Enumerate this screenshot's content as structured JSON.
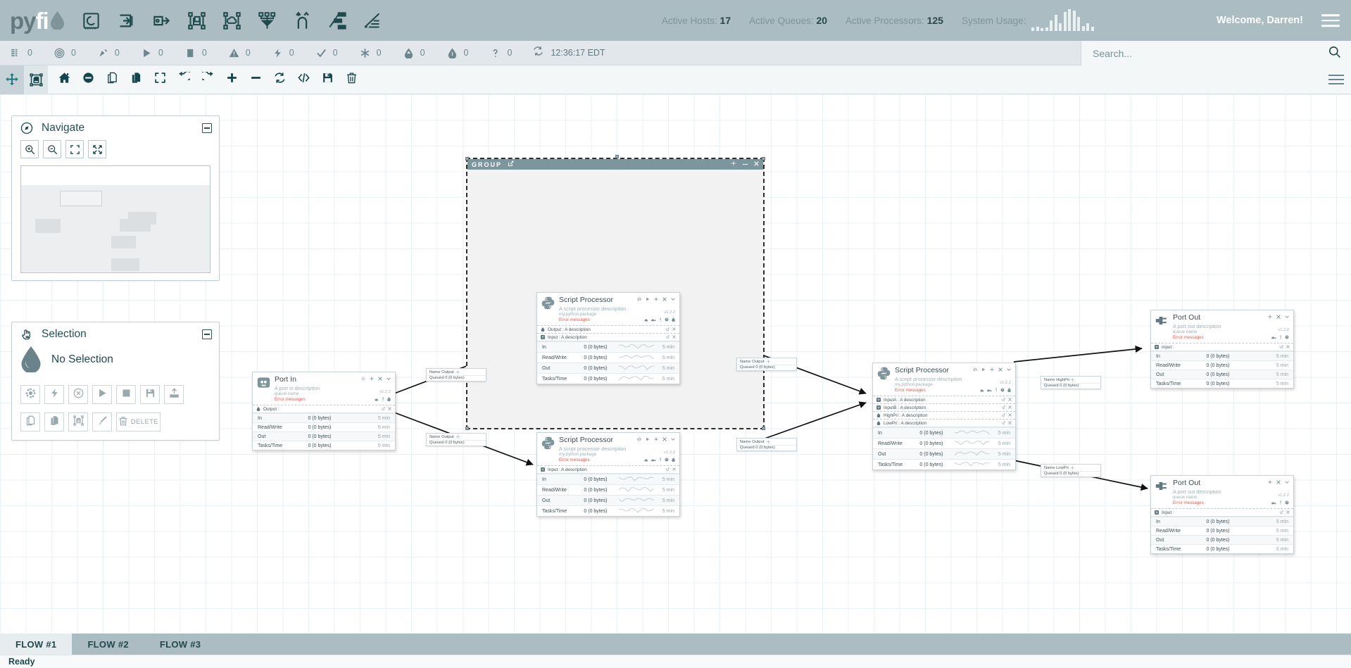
{
  "header": {
    "brand_py": "py",
    "brand_fi": "fi",
    "brand_icon": "water-drop-icon",
    "icons": [
      {
        "name": "refresh-circuit-icon"
      },
      {
        "name": "import-arrow-icon"
      },
      {
        "name": "export-arrow-icon"
      },
      {
        "name": "group-copy-icon"
      },
      {
        "name": "cloud-group-icon"
      },
      {
        "name": "merge-flow-icon"
      },
      {
        "name": "branch-flow-icon"
      },
      {
        "name": "network-node-icon"
      },
      {
        "name": "report-lines-icon"
      }
    ],
    "stats": [
      {
        "label": "Active Hosts:",
        "value": "17"
      },
      {
        "label": "Active Queues:",
        "value": "20"
      },
      {
        "label": "Active Processors:",
        "value": "125"
      },
      {
        "label": "System Usage:",
        "value": ""
      }
    ],
    "sparkline": [
      3,
      4,
      2,
      3,
      12,
      20,
      9,
      24,
      28,
      26,
      17,
      5,
      9,
      4
    ],
    "welcome": "Welcome, Darren!",
    "menu_icon": "hamburger-menu-icon"
  },
  "status_bar": {
    "items": [
      {
        "icon": "list-icon",
        "value": "0"
      },
      {
        "icon": "target-icon",
        "value": "0"
      },
      {
        "icon": "signal-icon",
        "value": "0"
      },
      {
        "icon": "play-icon",
        "value": "0"
      },
      {
        "icon": "stop-icon",
        "value": "0"
      },
      {
        "icon": "warning-icon",
        "value": "0"
      },
      {
        "icon": "bolt-icon",
        "value": "0"
      },
      {
        "icon": "check-icon",
        "value": "0"
      },
      {
        "icon": "asterisk-icon",
        "value": "0"
      },
      {
        "icon": "upload-drop-icon",
        "value": "0"
      },
      {
        "icon": "info-drop-icon",
        "value": "0"
      },
      {
        "icon": "question-icon",
        "value": "0"
      }
    ],
    "clock_icon": "refresh-icon",
    "clock": "12:36:17 EDT",
    "search": {
      "placeholder": "Search...",
      "value": "",
      "icon": "search-icon"
    }
  },
  "toolbar": {
    "buttons": [
      {
        "name": "pan-tool-button",
        "icon": "move-arrows-icon",
        "state": "selected"
      },
      {
        "name": "select-tool-button",
        "icon": "marquee-select-icon",
        "state": "selected2"
      },
      {
        "name": "home-button",
        "icon": "home-icon",
        "state": ""
      },
      {
        "name": "disable-button",
        "icon": "minus-circle-icon",
        "state": ""
      },
      {
        "name": "copy-button",
        "icon": "copy-icon",
        "state": ""
      },
      {
        "name": "paste-button",
        "icon": "paste-icon",
        "state": ""
      },
      {
        "name": "fit-screen-button",
        "icon": "fullscreen-icon",
        "state": ""
      },
      {
        "name": "undo-button",
        "icon": "undo-icon",
        "state": ""
      },
      {
        "name": "redo-button",
        "icon": "redo-icon",
        "state": ""
      },
      {
        "name": "zoom-in-button",
        "icon": "plus-icon",
        "state": ""
      },
      {
        "name": "zoom-out-button",
        "icon": "minus-icon",
        "state": ""
      },
      {
        "name": "refresh-button",
        "icon": "refresh-icon",
        "state": ""
      },
      {
        "name": "code-button",
        "icon": "code-brackets-icon",
        "state": ""
      },
      {
        "name": "save-button",
        "icon": "floppy-disk-icon",
        "state": ""
      },
      {
        "name": "delete-button",
        "icon": "trash-icon",
        "state": ""
      }
    ],
    "overflow_icon": "toolbar-overflow-icon"
  },
  "navigate_panel": {
    "title": "Navigate",
    "icon": "compass-icon",
    "collapse_icon": "collapse-icon",
    "buttons": [
      {
        "name": "zoom-in-button",
        "icon": "magnify-plus-icon"
      },
      {
        "name": "zoom-out-button",
        "icon": "magnify-minus-icon"
      },
      {
        "name": "fit-view-button",
        "icon": "fit-frame-icon"
      },
      {
        "name": "expand-view-button",
        "icon": "expand-arrows-icon"
      }
    ]
  },
  "selection_panel": {
    "title": "Selection",
    "icon": "hand-pointer-icon",
    "collapse_icon": "collapse-icon",
    "empty_text": "No Selection",
    "empty_icon": "water-drop-icon",
    "buttons": [
      {
        "name": "configure-button",
        "icon": "gear-icon",
        "label": ""
      },
      {
        "name": "enable-button",
        "icon": "bolt-icon",
        "label": ""
      },
      {
        "name": "disable-button",
        "icon": "x-circle-icon",
        "label": ""
      },
      {
        "name": "start-button",
        "icon": "play-icon",
        "label": ""
      },
      {
        "name": "stop-button",
        "icon": "stop-icon",
        "label": ""
      },
      {
        "name": "save-button",
        "icon": "floppy-disk-icon",
        "label": ""
      },
      {
        "name": "upload-button",
        "icon": "upload-icon",
        "label": ""
      },
      {
        "name": "copy-button",
        "icon": "copy-icon",
        "label": ""
      },
      {
        "name": "paste-button",
        "icon": "paste-icon",
        "label": ""
      },
      {
        "name": "group-button",
        "icon": "group-icon",
        "label": ""
      },
      {
        "name": "color-button",
        "icon": "paintbrush-icon",
        "label": ""
      },
      {
        "name": "delete-button",
        "icon": "trash-icon",
        "label": "DELETE"
      }
    ]
  },
  "group": {
    "label": "GROUP",
    "edit_icon": "edit-icon",
    "controls": [
      "gear-icon",
      "minimize-icon",
      "close-icon"
    ]
  },
  "nodes": [
    {
      "id": "port-in",
      "type": "port-in",
      "title": "Port In",
      "description": "A port in description",
      "package": "queue name",
      "error": "Error messages",
      "version": "v1.2.2",
      "icon": "power-outlet-icon",
      "controls": [
        "stop-circle-icon",
        "gear-icon",
        "close-icon",
        "chevron-down-icon"
      ],
      "badges": [
        "cloud-icon",
        "alert-icon",
        "drop-icon"
      ],
      "ports": [
        {
          "dir": "out",
          "label": "Output :",
          "icon": "output-drop-icon"
        }
      ],
      "stats": [
        {
          "label": "In",
          "value": "0 (0 bytes)",
          "time": "5 min"
        },
        {
          "label": "Read/Write",
          "value": "0 (0 bytes)",
          "time": "5 min"
        },
        {
          "label": "Out",
          "value": "0 (0 bytes)",
          "time": "5 min"
        },
        {
          "label": "Tasks/Time",
          "value": "0 (0 bytes)",
          "time": "5 min"
        }
      ]
    },
    {
      "id": "script-proc-top",
      "type": "script-processor",
      "title": "Script Processor",
      "description": "A script processor description",
      "package": "my.python.package",
      "error": "Error messages",
      "version": "v1.2.2",
      "icon": "python-icon",
      "controls": [
        "code-brackets-icon",
        "play-icon",
        "gear-icon",
        "close-icon",
        "chevron-down-icon"
      ],
      "badges": [
        "cloud-up-icon",
        "cloud-sync-icon",
        "alert-icon",
        "clock-icon",
        "drop-icon"
      ],
      "ports": [
        {
          "dir": "out",
          "label": "Output : A description",
          "icon": "output-drop-icon"
        },
        {
          "dir": "in",
          "label": "Input : A description",
          "icon": "input-socket-icon"
        }
      ],
      "stats": [
        {
          "label": "In",
          "value": "0 (0 bytes)",
          "time": "5 min"
        },
        {
          "label": "Read/Write",
          "value": "0 (0 bytes)",
          "time": "5 min"
        },
        {
          "label": "Out",
          "value": "0 (0 bytes)",
          "time": "5 min"
        },
        {
          "label": "Tasks/Time",
          "value": "0 (0 bytes)",
          "time": "5 min"
        }
      ]
    },
    {
      "id": "script-proc-bottom",
      "type": "script-processor",
      "title": "Script Processor",
      "description": "A script processor description",
      "package": "my.python.package",
      "error": "Error messages",
      "version": "v1.2.2",
      "icon": "python-icon",
      "controls": [
        "code-brackets-icon",
        "play-icon",
        "gear-icon",
        "close-icon",
        "chevron-down-icon"
      ],
      "badges": [
        "cloud-up-icon",
        "cloud-sync-icon",
        "alert-icon",
        "clock-icon",
        "drop-icon"
      ],
      "ports": [
        {
          "dir": "in",
          "label": "Input : A description",
          "icon": "input-socket-icon"
        }
      ],
      "stats": [
        {
          "label": "In",
          "value": "0 (0 bytes)",
          "time": "5 min"
        },
        {
          "label": "Read/Write",
          "value": "0 (0 bytes)",
          "time": "5 min"
        },
        {
          "label": "Out",
          "value": "0 (0 bytes)",
          "time": "5 min"
        },
        {
          "label": "Tasks/Time",
          "value": "0 (0 bytes)",
          "time": "5 min"
        }
      ]
    },
    {
      "id": "script-proc-right",
      "type": "script-processor",
      "title": "Script Processor",
      "description": "A script processor description",
      "package": "my.python.package",
      "error": "Error messages",
      "version": "v1.2.2",
      "icon": "python-icon",
      "controls": [
        "code-brackets-icon",
        "play-icon",
        "gear-icon",
        "close-icon",
        "chevron-down-icon"
      ],
      "badges": [
        "cloud-up-icon",
        "cloud-sync-icon",
        "alert-icon",
        "clock-icon",
        "drop-icon"
      ],
      "ports": [
        {
          "dir": "in",
          "label": "InputA : A description",
          "icon": "input-socket-icon"
        },
        {
          "dir": "in",
          "label": "InputB : A description",
          "icon": "input-socket-icon"
        },
        {
          "dir": "out",
          "label": "HighPri : A description",
          "icon": "output-drop-icon"
        },
        {
          "dir": "out",
          "label": "LowPri : A description",
          "icon": "output-drop-icon"
        }
      ],
      "stats": [
        {
          "label": "In",
          "value": "0 (0 bytes)",
          "time": "5 min"
        },
        {
          "label": "Read/Write",
          "value": "0 (0 bytes)",
          "time": "5 min"
        },
        {
          "label": "Out",
          "value": "0 (0 bytes)",
          "time": "5 min"
        },
        {
          "label": "Tasks/Time",
          "value": "0 (0 bytes)",
          "time": "5 min"
        }
      ]
    },
    {
      "id": "port-out-top",
      "type": "port-out",
      "title": "Port Out",
      "description": "A port out description",
      "package": "queue name",
      "error": "Error messages",
      "version": "v1.2.2",
      "icon": "plug-icon",
      "controls": [
        "gear-icon",
        "close-icon",
        "chevron-down-icon"
      ],
      "badges": [
        "cloud-sync-icon",
        "alert-icon",
        "clock-icon"
      ],
      "ports": [
        {
          "dir": "in",
          "label": "Input :",
          "icon": "input-socket-icon"
        }
      ],
      "stats": [
        {
          "label": "In",
          "value": "0 (0 bytes)",
          "time": "5 min"
        },
        {
          "label": "Read/Write",
          "value": "0 (0 bytes)",
          "time": "5 min"
        },
        {
          "label": "Out",
          "value": "0 (0 bytes)",
          "time": "5 min"
        },
        {
          "label": "Tasks/Time",
          "value": "0 (0 bytes)",
          "time": "5 min"
        }
      ]
    },
    {
      "id": "port-out-bottom",
      "type": "port-out",
      "title": "Port Out",
      "description": "A port out description",
      "package": "queue name",
      "error": "Error messages",
      "version": "v1.2.2",
      "icon": "plug-icon",
      "controls": [
        "gear-icon",
        "close-icon",
        "chevron-down-icon"
      ],
      "badges": [
        "cloud-sync-icon",
        "alert-icon",
        "clock-icon"
      ],
      "ports": [
        {
          "dir": "in",
          "label": "Input :",
          "icon": "input-socket-icon"
        }
      ],
      "stats": [
        {
          "label": "In",
          "value": "0 (0 bytes)",
          "time": "5 min"
        },
        {
          "label": "Read/Write",
          "value": "0 (0 bytes)",
          "time": "5 min"
        },
        {
          "label": "Out",
          "value": "0 (0 bytes)",
          "time": "5 min"
        },
        {
          "label": "Tasks/Time",
          "value": "0 (0 bytes)",
          "time": "5 min"
        }
      ]
    }
  ],
  "queues": [
    {
      "id": "q1",
      "name": "Name Output",
      "count": "Queued 0 (0 bytes)"
    },
    {
      "id": "q2",
      "name": "Name Output",
      "count": "Queued 0 (0 bytes)"
    },
    {
      "id": "q3",
      "name": "Name Output",
      "count": "Queued 0 (0 bytes)"
    },
    {
      "id": "q4",
      "name": "Name Output",
      "count": "Queued 0 (0 bytes)"
    },
    {
      "id": "q5",
      "name": "Name HighPri",
      "count": "Queued 0 (0 bytes)"
    },
    {
      "id": "q6",
      "name": "Name LowPri",
      "count": "Queued 0 (0 bytes)"
    }
  ],
  "tabs": [
    {
      "label": "FLOW #1",
      "active": true
    },
    {
      "label": "FLOW #2",
      "active": false
    },
    {
      "label": "FLOW #3",
      "active": false
    }
  ],
  "statusline": "Ready",
  "colors": {
    "header_bg": "#abbcc2",
    "accent": "#1f4a4d",
    "error": "#e8584f",
    "group_header": "#7d959d"
  }
}
